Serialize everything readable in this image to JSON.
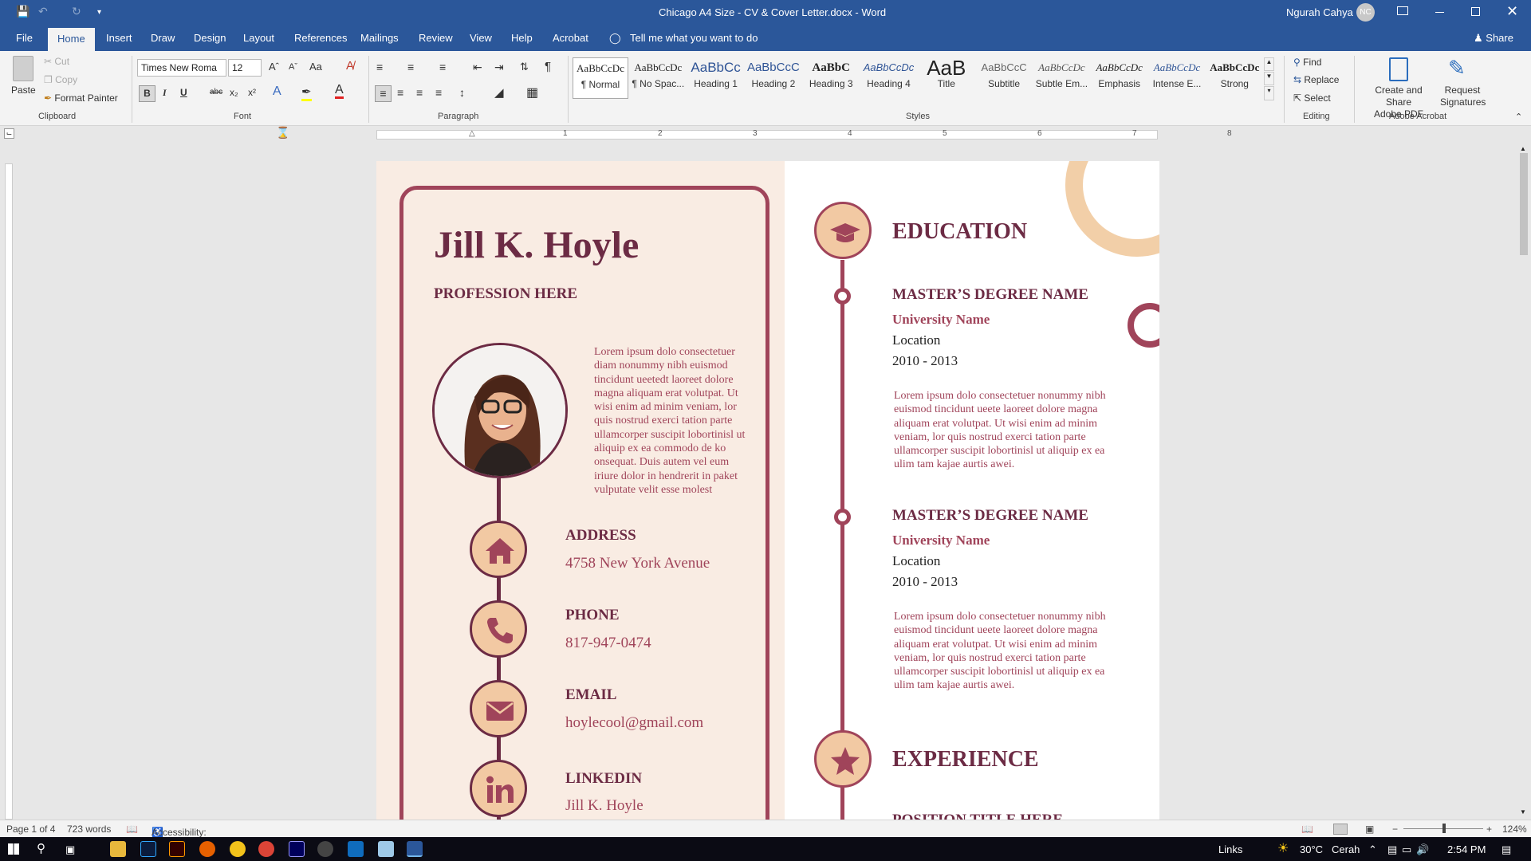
{
  "window": {
    "title": "Chicago A4 Size - CV & Cover Letter.docx - Word",
    "user": "Ngurah Cahya",
    "user_initials": "NC",
    "share": "Share"
  },
  "tabs": [
    "File",
    "Home",
    "Insert",
    "Draw",
    "Design",
    "Layout",
    "References",
    "Mailings",
    "Review",
    "View",
    "Help",
    "Acrobat"
  ],
  "tell_me": "Tell me what you want to do",
  "ribbon": {
    "clipboard": {
      "paste": "Paste",
      "cut": "Cut",
      "copy": "Copy",
      "format_painter": "Format Painter",
      "label": "Clipboard"
    },
    "font": {
      "name": "Times New Roma",
      "size": "12",
      "label": "Font",
      "case": "Aa"
    },
    "paragraph": {
      "label": "Paragraph"
    },
    "styles": {
      "label": "Styles",
      "items": [
        {
          "preview": "AaBbCcDc",
          "name": "¶ Normal"
        },
        {
          "preview": "AaBbCcDc",
          "name": "¶ No Spac..."
        },
        {
          "preview": "AaBbCc",
          "name": "Heading 1"
        },
        {
          "preview": "AaBbCcC",
          "name": "Heading 2"
        },
        {
          "preview": "AaBbC",
          "name": "Heading 3"
        },
        {
          "preview": "AaBbCcDc",
          "name": "Heading 4"
        },
        {
          "preview": "AaB",
          "name": "Title"
        },
        {
          "preview": "AaBbCcC",
          "name": "Subtitle"
        },
        {
          "preview": "AaBbCcDc",
          "name": "Subtle Em..."
        },
        {
          "preview": "AaBbCcDc",
          "name": "Emphasis"
        },
        {
          "preview": "AaBbCcDc",
          "name": "Intense E..."
        },
        {
          "preview": "AaBbCcDc",
          "name": "Strong"
        }
      ]
    },
    "editing": {
      "find": "Find",
      "replace": "Replace",
      "select": "Select",
      "label": "Editing"
    },
    "acrobat": {
      "create": "Create and Share Adobe PDF",
      "create_l1": "Create and Share",
      "create_l2": "Adobe PDF",
      "request": "Request Signatures",
      "request_l1": "Request",
      "request_l2": "Signatures",
      "label": "Adobe Acrobat"
    }
  },
  "ruler_numbers": [
    "1",
    "2",
    "3",
    "4",
    "5",
    "6",
    "7",
    "8"
  ],
  "resume": {
    "name": "Jill K. Hoyle",
    "profession": "PROFESSION HERE",
    "bio": "Lorem ipsum dolo consectetuer diam nonummy nibh euismod tincidunt ueetedt laoreet dolore magna aliquam erat volutpat. Ut wisi enim ad minim veniam, lor quis nostrud exerci tation parte ullamcorper suscipit lobortinisl ut aliquip ex ea commodo de ko onsequat. Duis autem vel eum iriure dolor in hendrerit in paket vulputate velit esse molest",
    "contacts": [
      {
        "label": "ADDRESS",
        "value": "4758 New York Avenue",
        "icon": "home-icon"
      },
      {
        "label": "PHONE",
        "value": "817-947-0474",
        "icon": "phone-icon"
      },
      {
        "label": "EMAIL",
        "value": "hoylecool@gmail.com",
        "icon": "mail-icon"
      },
      {
        "label": "LINKEDIN",
        "value": "Jill K. Hoyle",
        "icon": "linkedin-icon"
      }
    ],
    "education_heading": "EDUCATION",
    "education": [
      {
        "degree": "MASTER’S DEGREE NAME",
        "university": "University Name",
        "location": "Location",
        "years": "2010 - 2013",
        "desc": "Lorem ipsum dolo consectetuer nonummy nibh euismod tincidunt ueete laoreet dolore magna aliquam erat volutpat. Ut wisi enim ad minim veniam, lor quis nostrud exerci tation parte ullamcorper suscipit lobortinisl ut aliquip ex ea ulim tam kajae aurtis awei."
      },
      {
        "degree": "MASTER’S DEGREE NAME",
        "university": "University Name",
        "location": "Location",
        "years": "2010 - 2013",
        "desc": "Lorem ipsum dolo consectetuer nonummy nibh euismod tincidunt ueete laoreet dolore magna aliquam erat volutpat. Ut wisi enim ad minim veniam, lor quis nostrud exerci tation parte ullamcorper suscipit lobortinisl ut aliquip ex ea ulim tam kajae aurtis awei."
      }
    ],
    "experience_heading": "EXPERIENCE",
    "experience_first": "POSITION TITLE HERE"
  },
  "status": {
    "page": "Page 1 of 4",
    "words": "723 words",
    "accessibility": "Accessibility: Investigate",
    "zoom": "124%"
  },
  "taskbar": {
    "links": "Links",
    "weather": "30°C",
    "weather_desc": "Cerah",
    "time": "2:54 PM"
  },
  "colors": {
    "accent": "#2b579a",
    "plum": "#6c2b44",
    "rose": "#a0445a",
    "peach": "#f2c9a3",
    "cream": "#f9ece3"
  }
}
